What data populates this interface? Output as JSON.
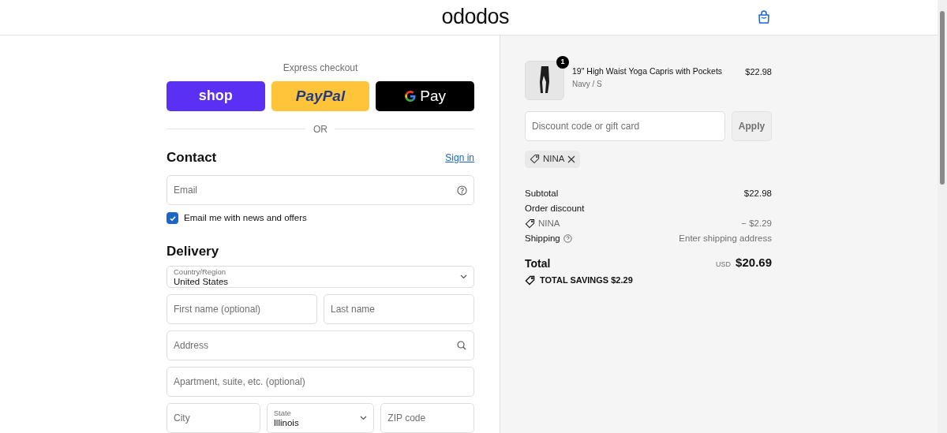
{
  "header": {
    "logo": "ododos"
  },
  "express_checkout": {
    "label": "Express checkout",
    "buttons": [
      {
        "kind": "shop",
        "label": "shop"
      },
      {
        "kind": "paypal",
        "label": "PayPal"
      },
      {
        "kind": "gpay",
        "label": "Pay"
      }
    ],
    "divider": "OR"
  },
  "contact": {
    "title": "Contact",
    "sign_in": "Sign in",
    "email": {
      "placeholder": "Email"
    },
    "newsletter": {
      "label": "Email me with news and offers",
      "checked": true
    }
  },
  "delivery": {
    "title": "Delivery",
    "country": {
      "label": "Country/Region",
      "value": "United States"
    },
    "rows": [
      [
        {
          "placeholder": "First name (optional)"
        },
        {
          "placeholder": "Last name"
        }
      ],
      [
        {
          "placeholder": "Address",
          "kind": "search"
        }
      ],
      [
        {
          "placeholder": "Apartment, suite, etc. (optional)"
        }
      ],
      [
        {
          "placeholder": "City"
        },
        {
          "kind": "select",
          "label": "State",
          "value": "Illinois"
        },
        {
          "placeholder": "ZIP code"
        }
      ]
    ]
  },
  "order_summary": {
    "item": {
      "quantity": "1",
      "name": "19\" High Waist Yoga Capris with Pockets",
      "variant": "Navy / S",
      "price": "$22.98"
    },
    "discount_field": {
      "placeholder": "Discount code or gift card",
      "button": "Apply"
    },
    "applied_code": "NINA",
    "lines": [
      {
        "label": "Subtotal",
        "value": "$22.98"
      },
      {
        "label": "Order discount",
        "kind": "heading"
      },
      {
        "label": "NINA",
        "value": "− $2.29",
        "kind": "code"
      },
      {
        "label": "Shipping",
        "value": "Enter shipping address",
        "kind": "help"
      }
    ],
    "total": {
      "label": "Total",
      "currency": "USD",
      "value": "$20.69"
    },
    "savings": "TOTAL SAVINGS $2.29"
  }
}
